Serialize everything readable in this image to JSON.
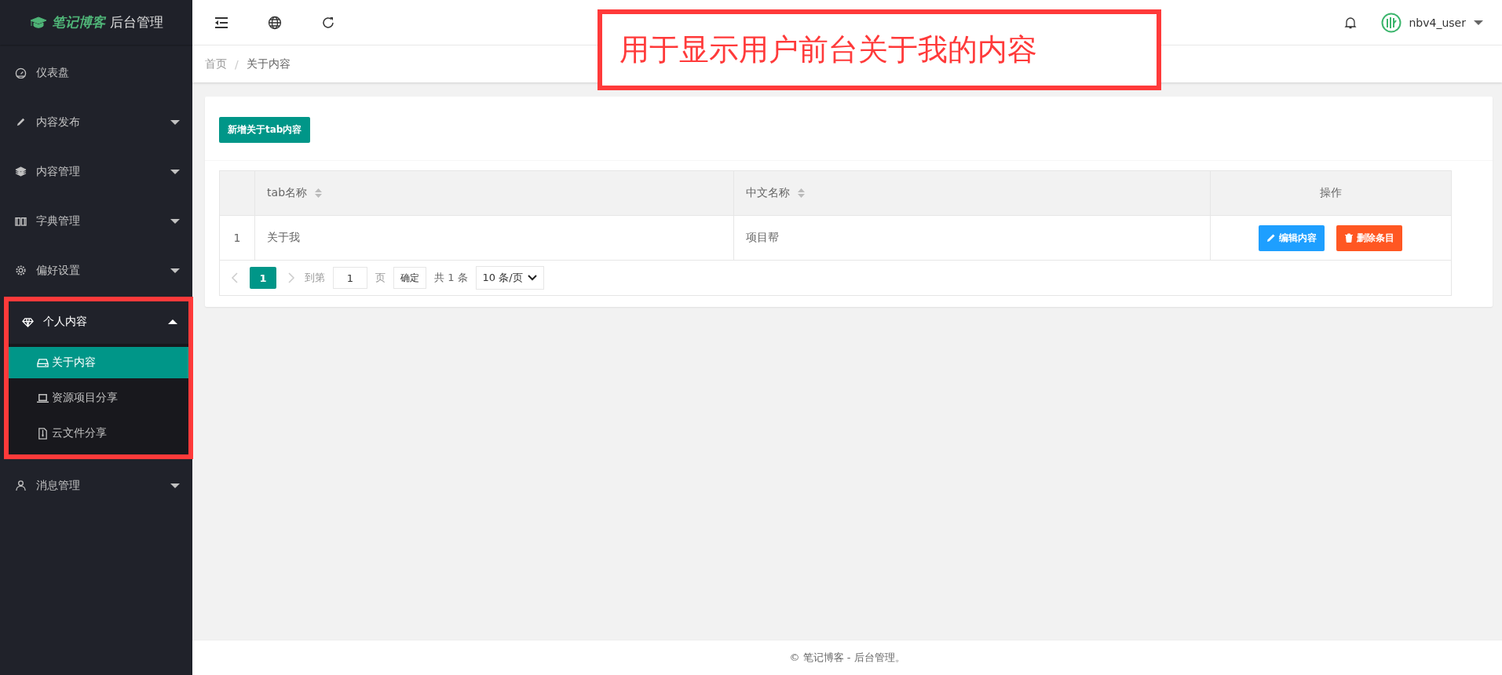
{
  "brand": {
    "accent": "笔记博客",
    "title": "后台管理"
  },
  "header": {
    "user": "nbv4_user"
  },
  "annotation": {
    "text": "用于显示用户前台关于我的内容"
  },
  "sidebar": {
    "items": [
      {
        "label": "仪表盘",
        "kind": "link"
      },
      {
        "label": "内容发布",
        "kind": "group",
        "expanded": false,
        "annotated": false
      },
      {
        "label": "内容管理",
        "kind": "group",
        "expanded": false,
        "annotated": false
      },
      {
        "label": "字典管理",
        "kind": "group",
        "expanded": false,
        "annotated": false
      },
      {
        "label": "偏好设置",
        "kind": "group",
        "expanded": false,
        "annotated": false
      },
      {
        "label": "个人内容",
        "kind": "group",
        "expanded": true,
        "annotated": true,
        "children": [
          {
            "label": "关于内容",
            "selected": true
          },
          {
            "label": "资源项目分享",
            "selected": false
          },
          {
            "label": "云文件分享",
            "selected": false
          }
        ]
      },
      {
        "label": "消息管理",
        "kind": "group",
        "expanded": false,
        "annotated": false
      }
    ]
  },
  "breadcrumb": {
    "items": [
      "首页",
      "关于内容"
    ],
    "separator": "/"
  },
  "add_button": "新增关于tab内容",
  "table": {
    "columns": [
      {
        "label": "tab名称",
        "sortable": true
      },
      {
        "label": "中文名称",
        "sortable": true
      },
      {
        "label": "操作",
        "sortable": false
      }
    ],
    "rows": [
      {
        "index": "1",
        "cells": [
          "关于我",
          "项目帮"
        ],
        "actions": [
          {
            "label": "编辑内容",
            "kind": "edit"
          },
          {
            "label": "删除条目",
            "kind": "delete"
          }
        ]
      }
    ]
  },
  "pagination": {
    "pages": [
      {
        "label": "1",
        "selected": true
      }
    ],
    "goto_label": "到第",
    "goto_value": "1",
    "page_suffix": "页",
    "confirm": "确定",
    "total": "共 1 条",
    "page_size": "10 条/页"
  },
  "footer": "© 笔记博客 - 后台管理。"
}
